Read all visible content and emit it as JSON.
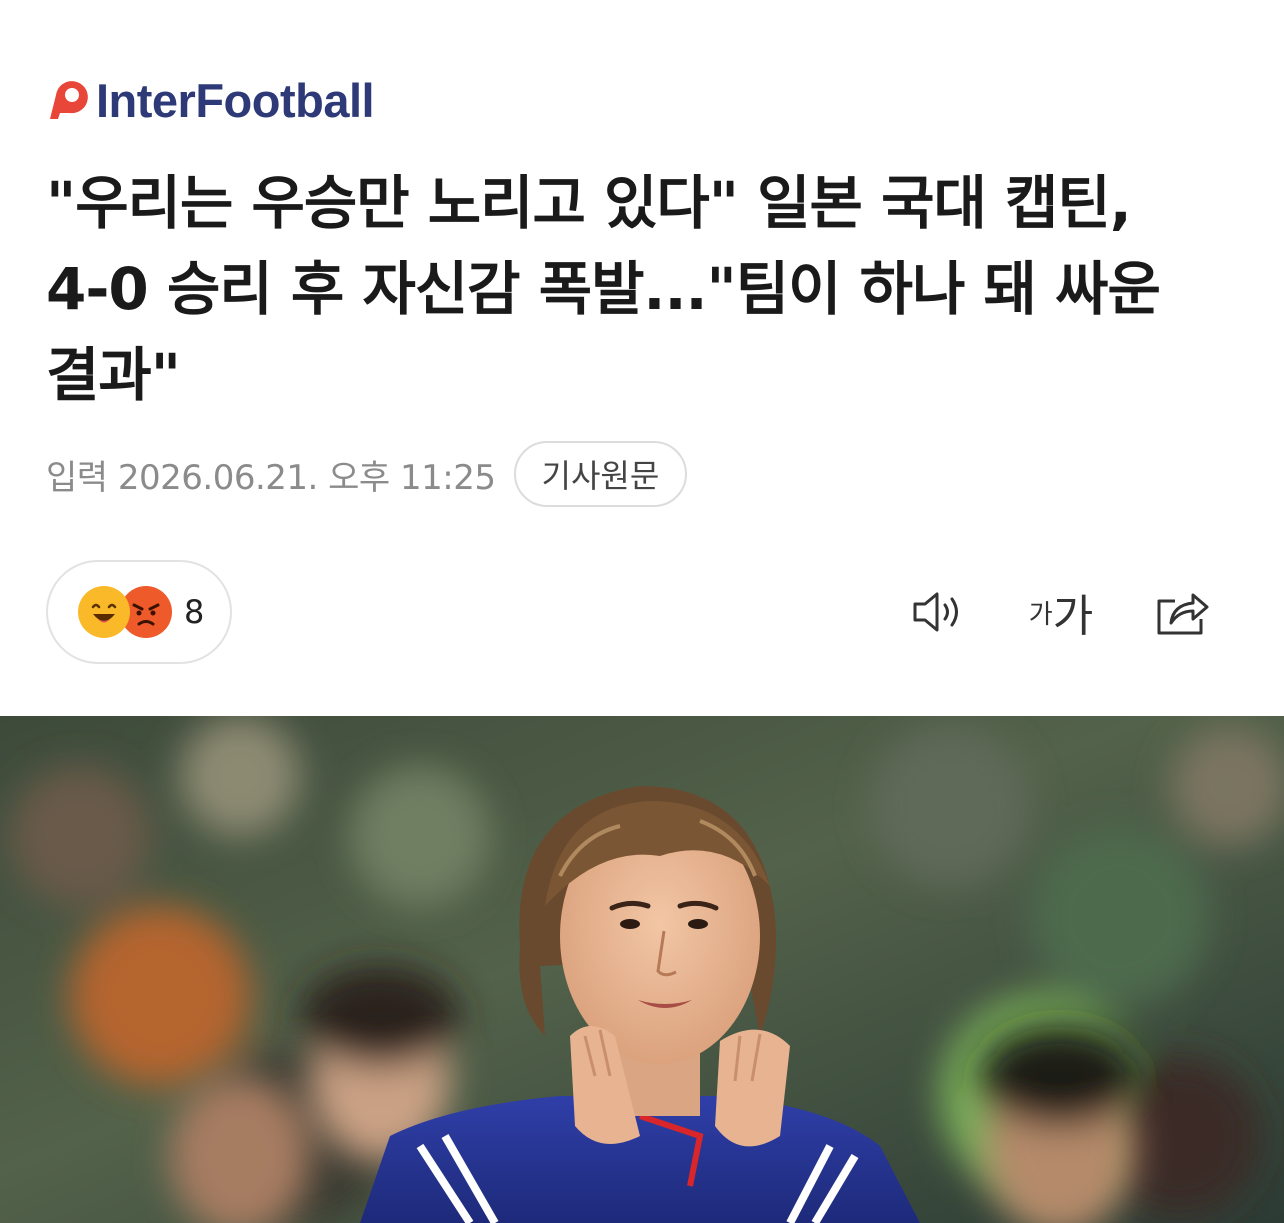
{
  "publisher": {
    "name": "InterFootball",
    "brand_color": "#2e3a78",
    "mark_color": "#e9463a"
  },
  "article": {
    "headline_lines": [
      "\"우리는 우승만 노리고 있다\" 일본 국대 캡틴,",
      "4-0 승리 후 자신감 폭발...\"팀이 하나 돼 싸운",
      "결과\""
    ],
    "published": "입력 2026.06.21. 오후 11:25",
    "source_link_label": "기사원문"
  },
  "reactions": {
    "icons": [
      "laughing-emoji",
      "angry-emoji"
    ],
    "count": "8"
  },
  "toolbar": {
    "listen_icon": "speaker-icon",
    "font_size_small": "가",
    "font_size_large": "가",
    "share_icon": "share-icon"
  },
  "photo": {
    "subject": "article-photo"
  }
}
